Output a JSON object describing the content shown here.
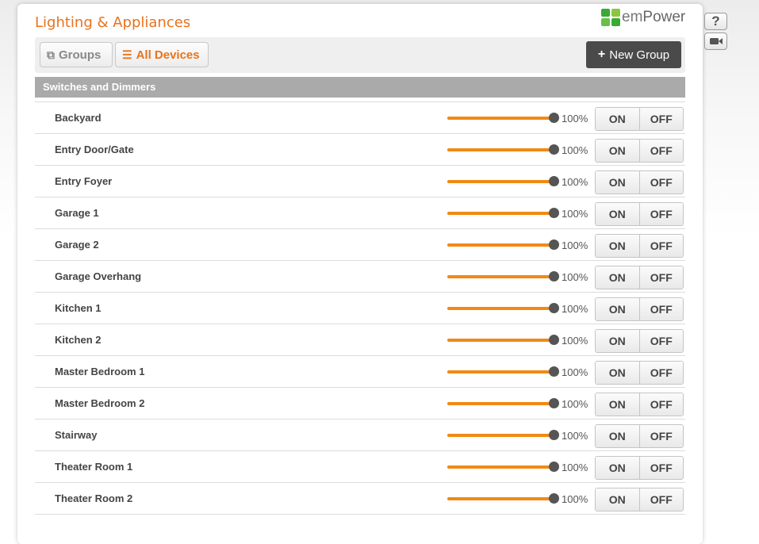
{
  "title": "Lighting & Appliances",
  "brand": {
    "text_em": "em",
    "text_power": "Power",
    "mark_colors": [
      "#3aaa35",
      "#8cc63f",
      "#6abf4b",
      "#3aaa35"
    ]
  },
  "toolbar": {
    "groups_label": "Groups",
    "all_devices_label": "All Devices",
    "new_group_label": "New Group"
  },
  "section_title": "Switches and Dimmers",
  "devices": [
    {
      "name": "Backyard",
      "level": 100,
      "level_label": "100%"
    },
    {
      "name": "Entry Door/Gate",
      "level": 100,
      "level_label": "100%"
    },
    {
      "name": "Entry Foyer",
      "level": 100,
      "level_label": "100%"
    },
    {
      "name": "Garage 1",
      "level": 100,
      "level_label": "100%"
    },
    {
      "name": "Garage 2",
      "level": 100,
      "level_label": "100%"
    },
    {
      "name": "Garage Overhang",
      "level": 100,
      "level_label": "100%"
    },
    {
      "name": "Kitchen 1",
      "level": 100,
      "level_label": "100%"
    },
    {
      "name": "Kitchen 2",
      "level": 100,
      "level_label": "100%"
    },
    {
      "name": "Master Bedroom 1",
      "level": 100,
      "level_label": "100%"
    },
    {
      "name": "Master Bedroom 2",
      "level": 100,
      "level_label": "100%"
    },
    {
      "name": "Stairway",
      "level": 100,
      "level_label": "100%"
    },
    {
      "name": "Theater Room 1",
      "level": 100,
      "level_label": "100%"
    },
    {
      "name": "Theater Room 2",
      "level": 100,
      "level_label": "100%"
    }
  ],
  "buttons": {
    "on_label": "ON",
    "off_label": "OFF"
  },
  "side": {
    "help_label": "?",
    "video_icon": "video-camera-icon"
  },
  "colors": {
    "accent": "#e8731d",
    "slider_fill": "#f08a15"
  }
}
